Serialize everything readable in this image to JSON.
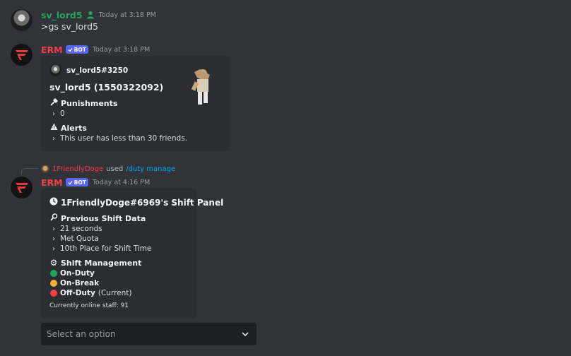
{
  "messages": [
    {
      "username": "sv_lord5",
      "timestamp": "Today at 3:18 PM",
      "content": ">gs sv_lord5"
    },
    {
      "username": "ERM",
      "bot_tag": "BOT",
      "timestamp": "Today at 3:18 PM",
      "embed": {
        "author": "sv_lord5#3250",
        "title": "sv_lord5 (1550322092)",
        "fields": [
          {
            "name": "Punishments",
            "icon": "hammer-icon",
            "value": "0"
          },
          {
            "name": "Alerts",
            "icon": "warning-icon",
            "value": "This user has less than 30 friends."
          }
        ]
      }
    },
    {
      "reply": {
        "user": "1FriendlyDoge",
        "action": "used",
        "command": "/duty manage"
      },
      "username": "ERM",
      "bot_tag": "BOT",
      "timestamp": "Today at 4:16 PM",
      "embed": {
        "title": "1FriendlyDoge#6969's Shift Panel",
        "previous": {
          "name": "Previous Shift Data",
          "lines": [
            "21 seconds",
            "Met Quota",
            "10th Place for Shift Time"
          ]
        },
        "management": {
          "name": "Shift Management",
          "items": [
            {
              "label": "On-Duty",
              "suffix": "",
              "color": "#23a559"
            },
            {
              "label": "On-Break",
              "suffix": "",
              "color": "#f0b232"
            },
            {
              "label": "Off-Duty",
              "suffix": "(Current)",
              "color": "#f23f42"
            }
          ]
        },
        "footer": "Currently online staff: 91"
      },
      "select": {
        "placeholder": "Select an option"
      }
    }
  ]
}
